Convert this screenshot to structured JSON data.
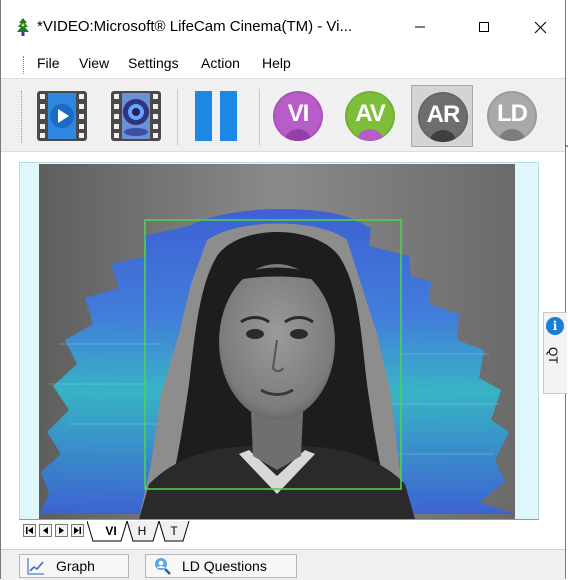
{
  "window": {
    "title": "*VIDEO:Microsoft® LifeCam Cinema(TM) - Vi...",
    "min_icon": "minimize-icon",
    "max_icon": "maximize-icon",
    "close_icon": "close-icon"
  },
  "menu": {
    "items": [
      "File",
      "View",
      "Settings",
      "Action",
      "Help"
    ]
  },
  "toolbar": {
    "play_icon": "film-play-icon",
    "webcam_icon": "film-webcam-icon",
    "pause_icon": "pause-icon",
    "modes": [
      {
        "label": "VI",
        "color": "#b85cc8",
        "active": false
      },
      {
        "label": "AV",
        "color": "#7dbf3b",
        "active": false
      },
      {
        "label": "AR",
        "color": "#6e6e6e",
        "active": true
      },
      {
        "label": "LD",
        "color": "#a9a9a9",
        "active": false
      }
    ],
    "overflow_glyph": "⌄"
  },
  "side_panel": {
    "label": "QT",
    "info_glyph": "i"
  },
  "video": {
    "overlay_box_color": "#4cd24c",
    "aura_colors": [
      "#3a5fd8",
      "#35b7c9",
      "#5aa7e6"
    ]
  },
  "sheet_tabs": [
    "VI",
    "H",
    "T"
  ],
  "active_sheet": "VI",
  "status_bar": {
    "graph_label": "Graph",
    "ld_questions_label": "LD Questions"
  }
}
